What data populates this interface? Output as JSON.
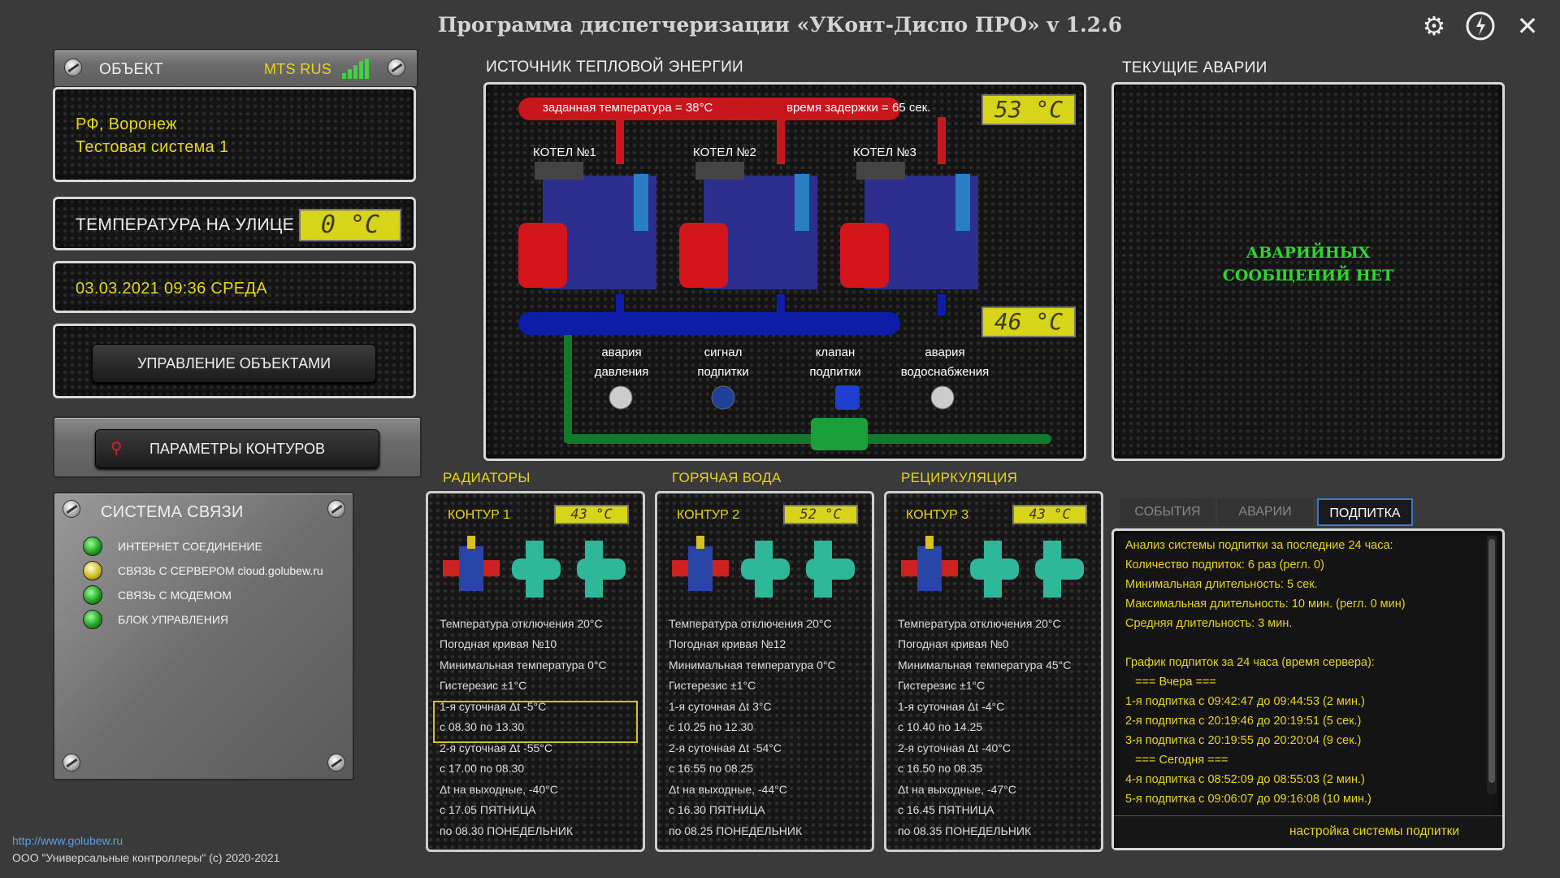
{
  "app": {
    "title": "Программа диспетчеризации «УКонт-Диспо ПРО» v 1.2.6"
  },
  "object_panel": {
    "header": "ОБЪЕКТ",
    "operator": "MTS RUS",
    "line1": "РФ, Воронеж",
    "line2": "Тестовая система 1"
  },
  "outdoor": {
    "label": "ТЕМПЕРАТУРА НА УЛИЦЕ",
    "value": "0 °C"
  },
  "datetime": {
    "text": "03.03.2021  09:36  СРЕДА"
  },
  "buttons": {
    "manage_objects": "УПРАВЛЕНИЕ ОБЪЕКТАМИ",
    "contour_params": "ПАРАМЕТРЫ КОНТУРОВ"
  },
  "comm": {
    "header": "СИСТЕМА СВЯЗИ",
    "items": [
      {
        "label": "ИНТЕРНЕТ СОЕДИНЕНИЕ",
        "status": "green"
      },
      {
        "label": "СВЯЗЬ С СЕРВЕРОМ cloud.golubew.ru",
        "status": "yellow"
      },
      {
        "label": "СВЯЗЬ С МОДЕМОМ",
        "status": "green"
      },
      {
        "label": "БЛОК УПРАВЛЕНИЯ",
        "status": "green"
      }
    ]
  },
  "heat_source": {
    "header": "ИСТОЧНИК ТЕПЛОВОЙ ЭНЕРГИИ",
    "set_temp": "заданная температура = 38°C",
    "delay": "время задержки = 65 сек.",
    "supply_temp": "53 °C",
    "return_temp": "46 °C",
    "boilers": [
      "КОТЕЛ №1",
      "КОТЕЛ №2",
      "КОТЕЛ №3"
    ],
    "sensors": [
      {
        "line1": "авария",
        "line2": "давления"
      },
      {
        "line1": "сигнал",
        "line2": "подпитки"
      },
      {
        "line1": "клапан",
        "line2": "подпитки"
      },
      {
        "line1": "авария",
        "line2": "водоснабжения"
      }
    ]
  },
  "alarms": {
    "header": "ТЕКУЩИЕ АВАРИИ",
    "line1": "АВАРИЙНЫХ",
    "line2": "СООБЩЕНИЙ НЕТ"
  },
  "contours": [
    {
      "group": "РАДИАТОРЫ",
      "name": "КОНТУР 1",
      "temp": "43 °C",
      "lines": [
        "Температура отключения 20°C",
        "Погодная кривая №10",
        "Минимальная температура 0°C",
        "Гистерезис ±1°C",
        "1-я суточная Δt -5°C",
        "с 08.30 по 13.30",
        "2-я суточная Δt -55°C",
        "с 17.00 по 08.30",
        "Δt на выходные, -40°C",
        "с 17.05 ПЯТНИЦА",
        "по 08.30 ПОНЕДЕЛЬНИК"
      ]
    },
    {
      "group": "ГОРЯЧАЯ ВОДА",
      "name": "КОНТУР 2",
      "temp": "52 °C",
      "lines": [
        "Температура отключения 20°C",
        "Погодная кривая №12",
        "Минимальная температура 0°C",
        "Гистерезис ±1°C",
        "1-я суточная Δt 3°C",
        "с 10.25 по 12.30",
        "2-я суточная Δt -54°C",
        "с 16:55 по 08.25",
        "Δt на выходные, -44°C",
        "с 16.30 ПЯТНИЦА",
        "по 08.25 ПОНЕДЕЛЬНИК"
      ]
    },
    {
      "group": "РЕЦИРКУЛЯЦИЯ",
      "name": "КОНТУР 3",
      "temp": "43 °C",
      "lines": [
        "Температура отключения 20°C",
        "Погодная кривая №0",
        "Минимальная температура 45°C",
        "Гистерезис ±1°C",
        "1-я суточная Δt -4°C",
        "с 10.40 по 14.25",
        "2-я суточная Δt -40°C",
        "с 16.50 по 08.35",
        "Δt на выходные, -47°C",
        "с 16.45 ПЯТНИЦА",
        "по 08.35 ПОНЕДЕЛЬНИК"
      ]
    }
  ],
  "log": {
    "tabs": [
      "СОБЫТИЯ",
      "АВАРИИ",
      "ПОДПИТКА"
    ],
    "active_tab": "ПОДПИТКА",
    "lines": [
      "Анализ системы подпитки за последние 24 часа:",
      "Количество подпиток: 6 раз (регл. 0)",
      "Минимальная длительность: 5 сек.",
      "Максимальная длительность: 10 мин. (регл. 0 мин)",
      "Средняя длительность: 3 мин.",
      "",
      "График подпиток за 24 часа (время сервера):",
      "   === Вчера ===",
      "1-я подпитка с 09:42:47 до 09:44:53 (2 мин.)",
      "2-я подпитка с 20:19:46 до 20:19:51 (5 сек.)",
      "3-я подпитка с 20:19:55 до 20:20:04 (9 сек.)",
      "   === Сегодня ===",
      "4-я подпитка с 08:52:09 до 08:55:03 (2 мин.)",
      "5-я подпитка с 09:06:07 до 09:16:08 (10 мин.)"
    ],
    "settings_link": "настройка системы подпитки"
  },
  "footer": {
    "url": "http://www.golubew.ru",
    "copyright": "ООО \"Универсальные контроллеры\" (c) 2020-2021"
  }
}
